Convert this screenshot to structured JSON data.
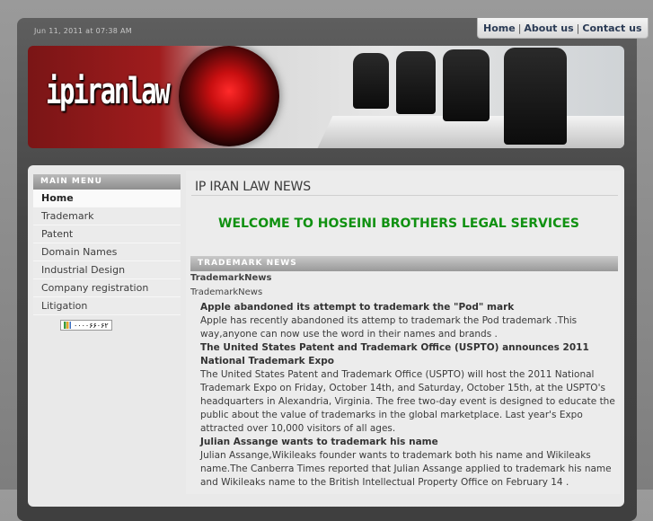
{
  "header": {
    "date_text": "Jun 11, 2011 at 07:38 AM",
    "nav": [
      "Home",
      "About us",
      "Contact us"
    ],
    "logo_text": "ipiranlaw"
  },
  "sidebar": {
    "title": "MAIN MENU",
    "items": [
      "Home",
      "Trademark",
      "Patent",
      "Domain Names",
      "Industrial Design",
      "Company registration",
      "Litigation"
    ],
    "counter": "۰۰۰۰۶۶۰۶۲"
  },
  "main": {
    "page_title": "IP IRAN LAW NEWS",
    "welcome": "WELCOME TO HOSEINI BROTHERS LEGAL SERVICES",
    "section_title": "TRADEMARK NEWS",
    "label_bold": "TrademarkNews",
    "label": "TrademarkNews",
    "articles": [
      {
        "heading": "Apple abandoned its attempt to trademark the \"Pod\" mark",
        "body": "Apple has recently abandoned its attemp to trademark the Pod trademark .This way,anyone can now use the word in their names and brands ."
      },
      {
        "heading": "The United States Patent and Trademark Office (USPTO) announces 2011 National Trademark Expo",
        "body": "The United States Patent and Trademark Office (USPTO) will host the 2011 National Trademark Expo on Friday, October 14th, and Saturday, October 15th, at the USPTO's headquarters in Alexandria, Virginia. The free two-day event is designed to educate the public about the value of trademarks in the global marketplace. Last year's Expo attracted over 10,000 visitors of all ages."
      },
      {
        "heading": "Julian Assange wants to trademark his name",
        "body": "Julian Assange,Wikileaks founder wants to trademark both his name and Wikileaks name.The Canberra Times reported that Julian Assange applied to trademark his name and Wikileaks name to the British Intellectual Property Office on February 14 ."
      }
    ]
  },
  "colors": {
    "welcome_green": "#109111",
    "nav_text": "#2b3b55",
    "frame_dark": "#454545"
  }
}
